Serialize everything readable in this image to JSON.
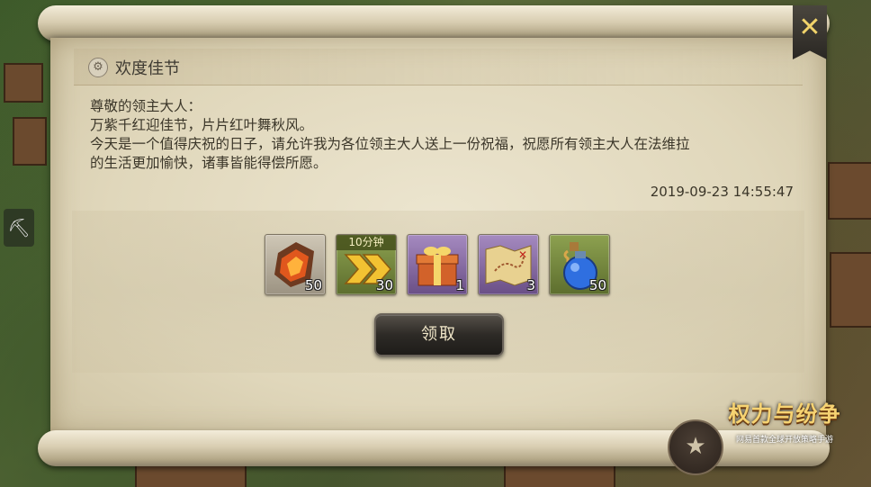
{
  "dialog": {
    "title": "欢度佳节",
    "lines": [
      "尊敬的领主大人：",
      "万紫千红迎佳节，片片红叶舞秋风。",
      "今天是一个值得庆祝的日子，请允许我为各位领主大人送上一份祝福，祝愿所有领主大人在法维拉",
      "的生活更加愉快，诸事皆能得偿所愿。"
    ],
    "timestamp": "2019-09-23 14:55:47",
    "claim_label": "领取",
    "close_label": "✕"
  },
  "rewards": [
    {
      "icon": "ore-icon",
      "count": "50",
      "rarity": "grey"
    },
    {
      "icon": "speedup-icon",
      "count": "30",
      "tag": "10分钟",
      "rarity": "green"
    },
    {
      "icon": "gift-box-icon",
      "count": "1",
      "rarity": "purple"
    },
    {
      "icon": "treasure-map-icon",
      "count": "3",
      "rarity": "purple"
    },
    {
      "icon": "potion-icon",
      "count": "50",
      "rarity": "green"
    }
  ],
  "logo": {
    "title": "权力与纷争",
    "subtitle": "网易首款全球开放策略手游"
  },
  "colors": {
    "parchment": "#e6dec5",
    "text": "#3b3629",
    "close_icon": "#f1d36a",
    "button_dark": "#2d2a26"
  }
}
